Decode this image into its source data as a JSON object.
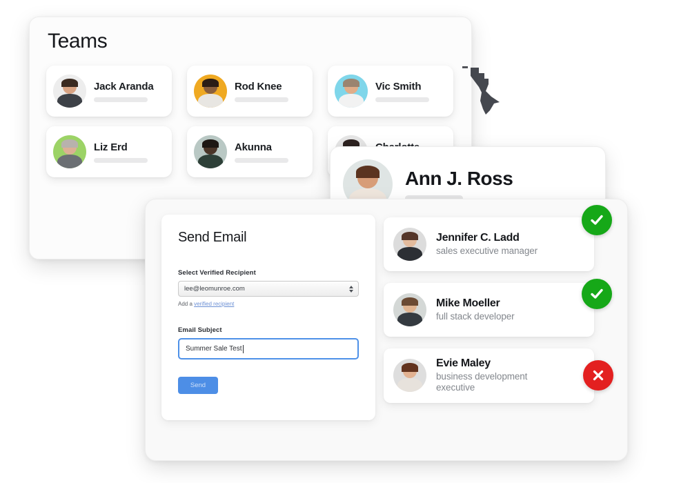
{
  "teams_panel": {
    "title": "Teams",
    "members": [
      {
        "name": "Jack Aranda",
        "avatar_bg": "#ededed",
        "skin": "#d8a383",
        "hair": "#3a2a20",
        "body": "#3d4147"
      },
      {
        "name": "Rod Knee",
        "avatar_bg": "#efa922",
        "skin": "#8a5f3d",
        "hair": "#2b1d16",
        "body": "#e8e6e2"
      },
      {
        "name": "Vic Smith",
        "avatar_bg": "#7fd6ea",
        "skin": "#e0ad89",
        "hair": "#9a8470",
        "body": "#f2f2f2"
      },
      {
        "name": "Liz Erd",
        "avatar_bg": "#9cd366",
        "skin": "#dcb094",
        "hair": "#b8b2ad",
        "body": "#6b6f73"
      },
      {
        "name": "Akunna",
        "avatar_bg": "#b9c8c4",
        "skin": "#4a3528",
        "hair": "#1d1713",
        "body": "#2e4038"
      },
      {
        "name": "Charlotte",
        "avatar_bg": "#e5e5e5",
        "skin": "#d9a988",
        "hair": "#2d2220",
        "body": "#ececec"
      }
    ]
  },
  "profile_panel": {
    "name": "Ann J. Ross",
    "avatar_bg": "#dfe5e4",
    "skin": "#d79d78",
    "hair": "#5b3420",
    "body": "#efe6dd"
  },
  "send_email_card": {
    "title": "Send Email",
    "recipient_label": "Select Verified Recipient",
    "recipient_value": "lee@leomunroe.com",
    "recipient_hint_prefix": "Add a ",
    "recipient_hint_link": "verified recipient",
    "subject_label": "Email Subject",
    "subject_value": "Summer Sale Test",
    "subject_placeholder": "Email Subject",
    "send_label": "Send",
    "accent_color": "#4d8ee6"
  },
  "contacts": {
    "items": [
      {
        "name": "Jennifer C. Ladd",
        "role": "sales executive manager",
        "status": "verified",
        "status_icon": "check-circle-icon",
        "avatar_bg": "#dcdcdc",
        "skin": "#e3bb9d",
        "hair": "#54362a",
        "body": "#2c2f34"
      },
      {
        "name": "Mike Moeller",
        "role": "full stack developer",
        "status": "verified",
        "status_icon": "check-circle-icon",
        "avatar_bg": "#d4d8d6",
        "skin": "#e0b491",
        "hair": "#6b4a33",
        "body": "#343a40"
      },
      {
        "name": "Evie Maley",
        "role": "business development executive",
        "status": "rejected",
        "status_icon": "x-circle-icon",
        "avatar_bg": "#dedede",
        "skin": "#e2b292",
        "hair": "#63341f",
        "body": "#e7e2dc"
      }
    ],
    "status_colors": {
      "verified": "#16a818",
      "rejected": "#e32020"
    }
  }
}
